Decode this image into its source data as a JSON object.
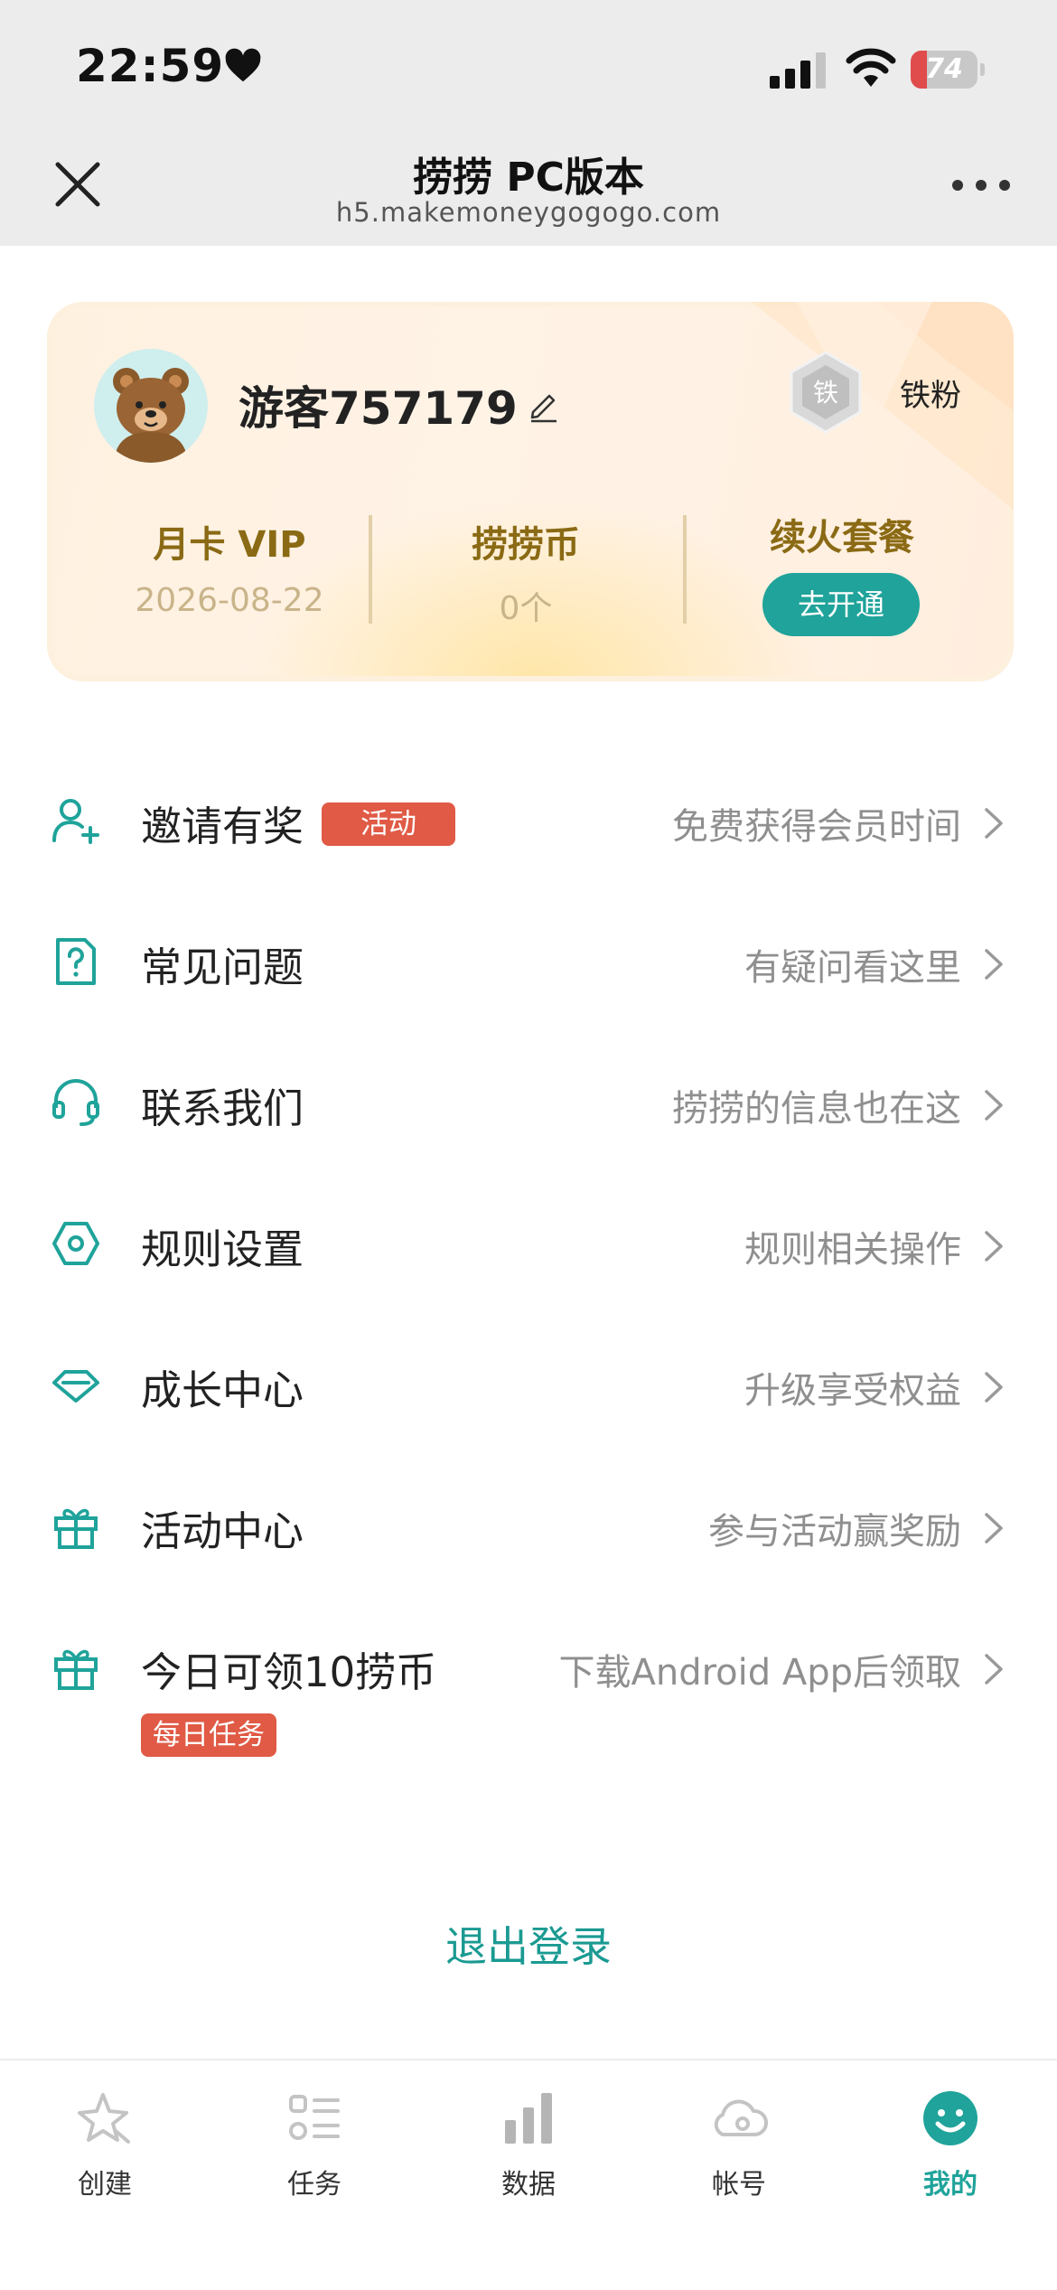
{
  "status_bar": {
    "time": "22:59",
    "battery": "74"
  },
  "nav": {
    "title": "捞捞 PC版本",
    "url": "h5.makemoneygogogo.com"
  },
  "profile": {
    "username": "游客757179",
    "badge_char": "铁",
    "badge_label": "铁粉",
    "stats": [
      {
        "label": "月卡 VIP",
        "value": "2026-08-22"
      },
      {
        "label": "捞捞币",
        "value": "0个"
      },
      {
        "label": "续火套餐",
        "button": "去开通"
      }
    ]
  },
  "menu": [
    {
      "label": "邀请有奖",
      "tag": "活动",
      "hint": "免费获得会员时间",
      "icon": "user-add-icon"
    },
    {
      "label": "常见问题",
      "hint": "有疑问看这里",
      "icon": "help-document-icon"
    },
    {
      "label": "联系我们",
      "hint": "捞捞的信息也在这",
      "icon": "headset-icon"
    },
    {
      "label": "规则设置",
      "hint": "规则相关操作",
      "icon": "hexagon-settings-icon"
    },
    {
      "label": "成长中心",
      "hint": "升级享受权益",
      "icon": "diamond-icon"
    },
    {
      "label": "活动中心",
      "hint": "参与活动赢奖励",
      "icon": "gift-icon"
    },
    {
      "label": "今日可领10捞币",
      "tag": "每日任务",
      "hint": "下载Android App后领取",
      "icon": "gift-icon"
    }
  ],
  "logout": "退出登录",
  "tabs": [
    {
      "label": "创建",
      "icon": "star-icon"
    },
    {
      "label": "任务",
      "icon": "task-list-icon"
    },
    {
      "label": "数据",
      "icon": "bar-chart-icon"
    },
    {
      "label": "帐号",
      "icon": "cloud-icon"
    },
    {
      "label": "我的",
      "icon": "smile-icon",
      "active": true
    }
  ],
  "colors": {
    "accent": "#1fa39a",
    "tag": "#e05a45",
    "gold_text": "#8a6a14"
  }
}
